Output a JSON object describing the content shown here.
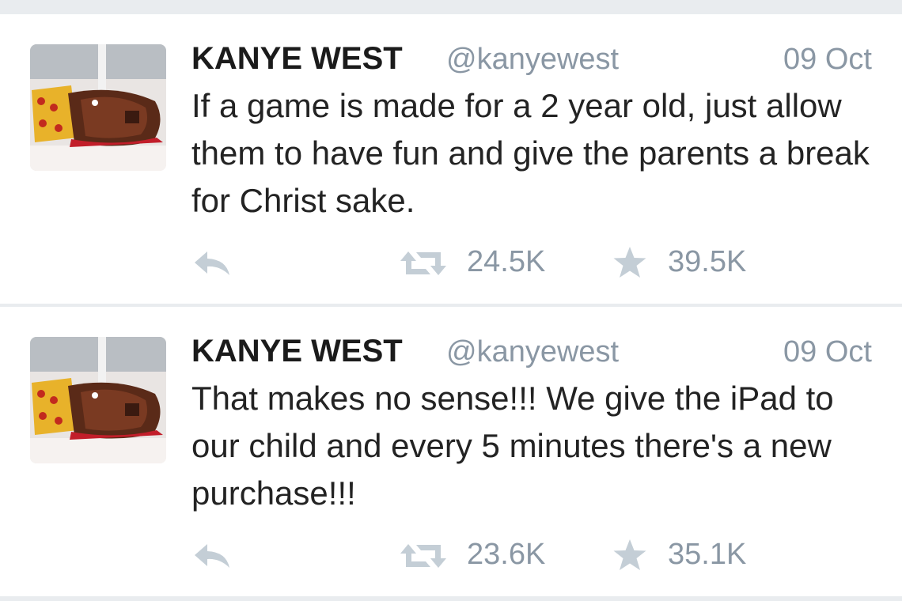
{
  "colors": {
    "text": "#232323",
    "name": "#1b1b1b",
    "meta": "#8a97a4",
    "icon": "#c4ced6",
    "background": "#e9ecef",
    "card": "#ffffff"
  },
  "tweets": [
    {
      "author_name": "KANYE WEST",
      "author_handle": "@kanyewest",
      "date": "09 Oct",
      "text": "If a game is made for a 2 year old, just allow them to have fun and give the parents a break for Christ sake.",
      "retweets": "24.5K",
      "favorites": "39.5K",
      "icons": [
        "reply-icon",
        "retweet-icon",
        "star-icon"
      ]
    },
    {
      "author_name": "KANYE WEST",
      "author_handle": "@kanyewest",
      "date": "09 Oct",
      "text": "That makes no sense!!! We give the iPad to our child and every 5 minutes there's a new purchase!!!",
      "retweets": "23.6K",
      "favorites": "35.1K",
      "icons": [
        "reply-icon",
        "retweet-icon",
        "star-icon"
      ]
    }
  ]
}
